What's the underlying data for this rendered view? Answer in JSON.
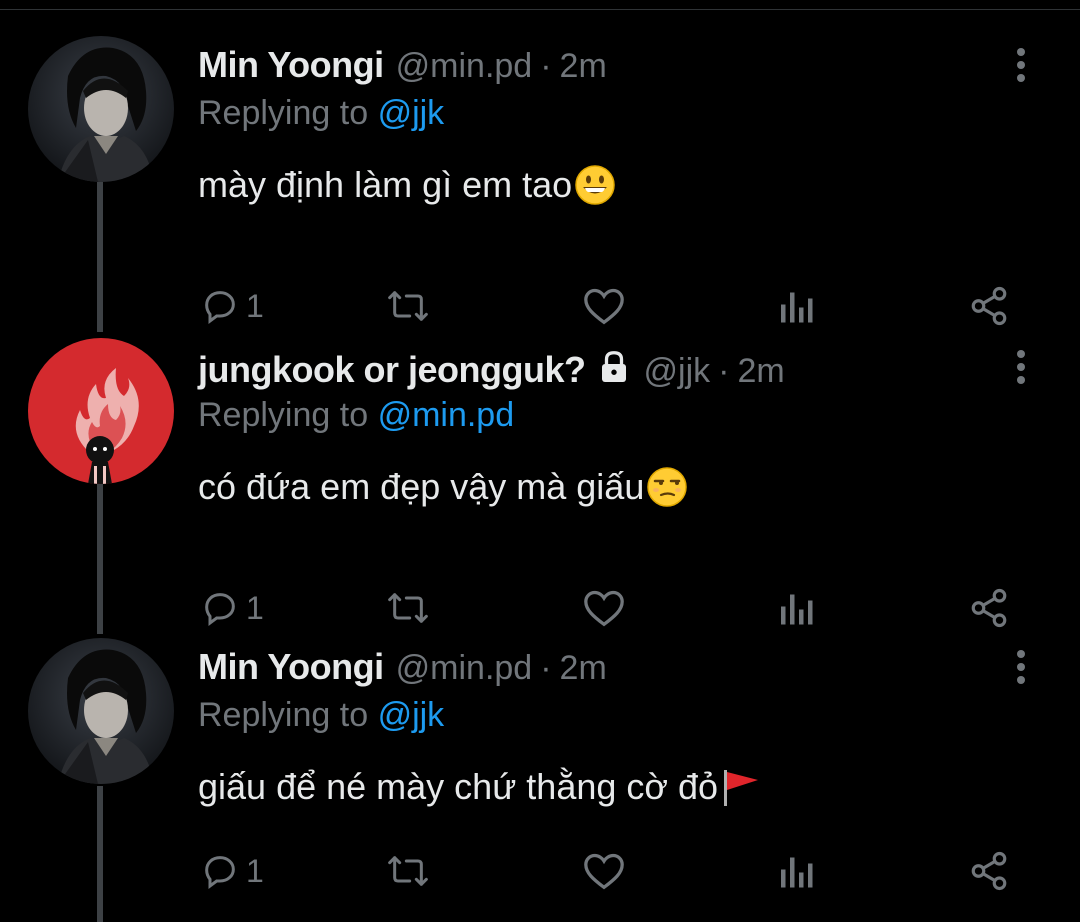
{
  "theme": {
    "background": "#000000",
    "text": "#e7e9ea",
    "muted": "#71767b",
    "link": "#1d9bf0",
    "thread_line": "#3d4145",
    "avatar_red": "#d42a2e"
  },
  "tweets": [
    {
      "display_name": "Min Yoongi",
      "handle": "@min.pd",
      "separator": "·",
      "time": "2m",
      "replying_prefix": "Replying to",
      "replying_to": "@jjk",
      "text": "mày định làm gì em tao",
      "emoji": "grinning-face-emoji",
      "reply_count": "1",
      "locked": false,
      "avatar": "portrait-avatar-icon"
    },
    {
      "display_name": "jungkook or jeongguk?",
      "handle": "@jjk",
      "separator": "·",
      "time": "2m",
      "replying_prefix": "Replying to",
      "replying_to": "@min.pd",
      "text": "có đứa em đẹp vậy mà giấu",
      "emoji": "unamused-face-emoji",
      "reply_count": "1",
      "locked": true,
      "avatar": "red-flame-avatar-icon"
    },
    {
      "display_name": "Min Yoongi",
      "handle": "@min.pd",
      "separator": "·",
      "time": "2m",
      "replying_prefix": "Replying to",
      "replying_to": "@jjk",
      "text": "giấu để né mày chứ thằng cờ đỏ",
      "emoji": "red-flag-emoji",
      "reply_count": "1",
      "locked": false,
      "avatar": "portrait-avatar-icon"
    }
  ],
  "icons": {
    "reply": "reply-icon",
    "retweet": "retweet-icon",
    "like": "heart-icon",
    "views": "analytics-icon",
    "share": "share-icon",
    "more": "more-options-icon",
    "lock": "lock-icon"
  }
}
